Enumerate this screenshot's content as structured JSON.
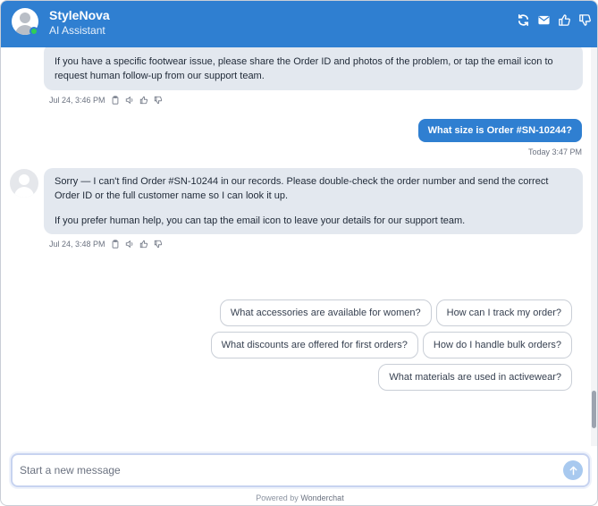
{
  "header": {
    "brand": "StyleNova",
    "subtitle": "AI Assistant",
    "icons": [
      "refresh-icon",
      "email-icon",
      "thumbs-up-icon",
      "thumbs-down-icon"
    ]
  },
  "messages": [
    {
      "role": "bot",
      "lines": [
        "If you have a specific footwear issue, please share the Order ID and photos of the problem, or tap the email icon to request human follow-up from our support team."
      ],
      "time": "Jul 24, 3:46 PM"
    },
    {
      "role": "user",
      "text": "What size is Order #SN-10244?",
      "time": "Today 3:47 PM"
    },
    {
      "role": "bot",
      "lines": [
        "Sorry — I can't find Order #SN-10244 in our records. Please double-check the order number and send the correct Order ID or the full customer name so I can look it up.",
        "If you prefer human help, you can tap the email icon to leave your details for our support team."
      ],
      "time": "Jul 24, 3:48 PM"
    }
  ],
  "suggestions": [
    [
      "What accessories are available for women?",
      "How can I track my order?"
    ],
    [
      "What discounts are offered for first orders?",
      "How do I handle bulk orders?"
    ],
    [
      "What materials are used in activewear?"
    ]
  ],
  "composer": {
    "placeholder": "Start a new message"
  },
  "footer": {
    "powered_by": "Powered by",
    "brand": "Wonderchat"
  },
  "colors": {
    "accent": "#2f7fd1",
    "bot_bubble": "#e3e8ef",
    "online": "#2fcf55"
  }
}
